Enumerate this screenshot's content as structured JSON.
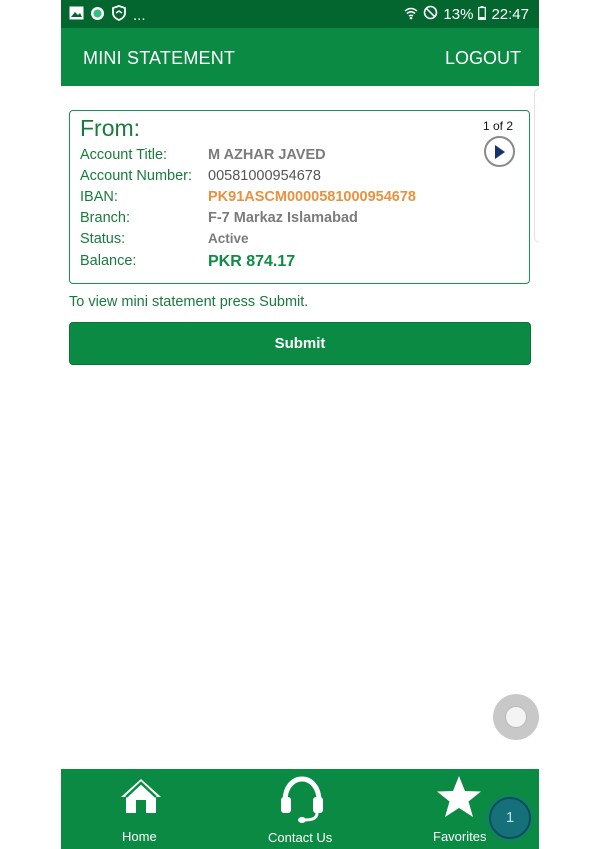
{
  "status_bar": {
    "notification_icons": [
      "image-icon",
      "green-dot-icon",
      "shield-icon"
    ],
    "ellipsis": "...",
    "wifi_icon": "wifi-icon",
    "dnd_icon": "do-not-disturb-icon",
    "battery_percent": "13%",
    "battery_icon": "battery-icon",
    "time": "22:47"
  },
  "header": {
    "title": "MINI STATEMENT",
    "logout_label": "LOGOUT"
  },
  "account_card": {
    "from_label": "From:",
    "pager": "1 of 2",
    "fields": {
      "account_title": {
        "label": "Account Title:",
        "value": "M AZHAR JAVED"
      },
      "account_number": {
        "label": "Account Number:",
        "value": "00581000954678"
      },
      "iban": {
        "label": "IBAN:",
        "value": "PK91ASCM0000581000954678"
      },
      "branch": {
        "label": "Branch:",
        "value": "F-7 Markaz Islamabad"
      },
      "status": {
        "label": "Status:",
        "value": "Active"
      },
      "balance": {
        "label": "Balance:",
        "value": "PKR 874.17"
      }
    }
  },
  "hint": "To view mini statement press Submit.",
  "submit_label": "Submit",
  "bottom_nav": {
    "items": [
      {
        "label": "Home",
        "icon": "home-icon"
      },
      {
        "label": "Contact Us",
        "icon": "headset-icon"
      },
      {
        "label": "Favorites",
        "icon": "star-icon"
      }
    ],
    "chat_badge": "1"
  },
  "colors": {
    "primary_green": "#0a8a43",
    "status_bar_green": "#03662f",
    "iban_orange": "#e8913f",
    "label_green": "#1a7a3e"
  }
}
